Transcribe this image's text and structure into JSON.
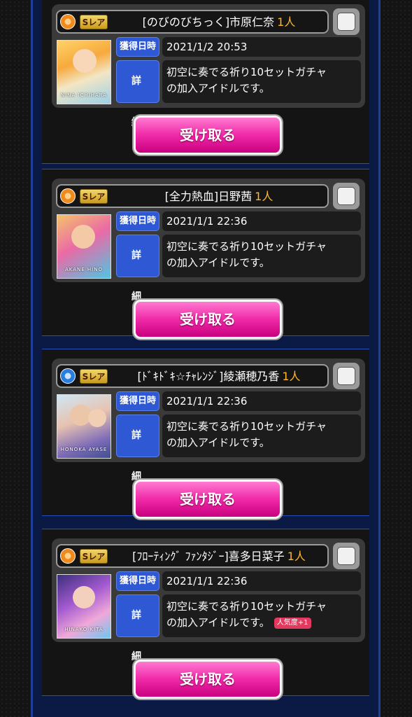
{
  "labels": {
    "date": "獲得日時",
    "detail": "詳 細",
    "receive": "受け取る",
    "rarity": "Sレア",
    "popularity_badge": "人気度+1"
  },
  "items": [
    {
      "idol": "[のびのびちっく]市原仁奈",
      "count": "1人",
      "date": "2021/1/2 20:53",
      "detail_line1": "初空に奏でる祈り10セットガチャ",
      "detail_line2": "の加入アイドルです。",
      "thumb_name": "NINA ICHIHARA",
      "icon": "sun-icon"
    },
    {
      "idol": "[全力熱血]日野茜",
      "count": "1人",
      "date": "2021/1/1 22:36",
      "detail_line1": "初空に奏でる祈り10セットガチャ",
      "detail_line2": "の加入アイドルです。",
      "thumb_name": "AKANE HINO",
      "icon": "sun-icon"
    },
    {
      "idol": "[ﾄﾞｷﾄﾞｷ☆ﾁｬﾚﾝｼﾞ]綾瀬穂乃香",
      "count": "1人",
      "date": "2021/1/1 22:36",
      "detail_line1": "初空に奏でる祈り10セットガチャ",
      "detail_line2": "の加入アイドルです。",
      "thumb_name": "HONOKA AYASE",
      "icon": "diamond-icon"
    },
    {
      "idol": "[ﾌﾛｰﾃｨﾝｸﾞ ﾌｧﾝﾀｼﾞｰ]喜多日菜子",
      "count": "1人",
      "date": "2021/1/1 22:36",
      "detail_line1": "初空に奏でる祈り10セットガチャ",
      "detail_line2": "の加入アイドルです。",
      "thumb_name": "HINAKO KITA",
      "icon": "sun-icon"
    }
  ]
}
